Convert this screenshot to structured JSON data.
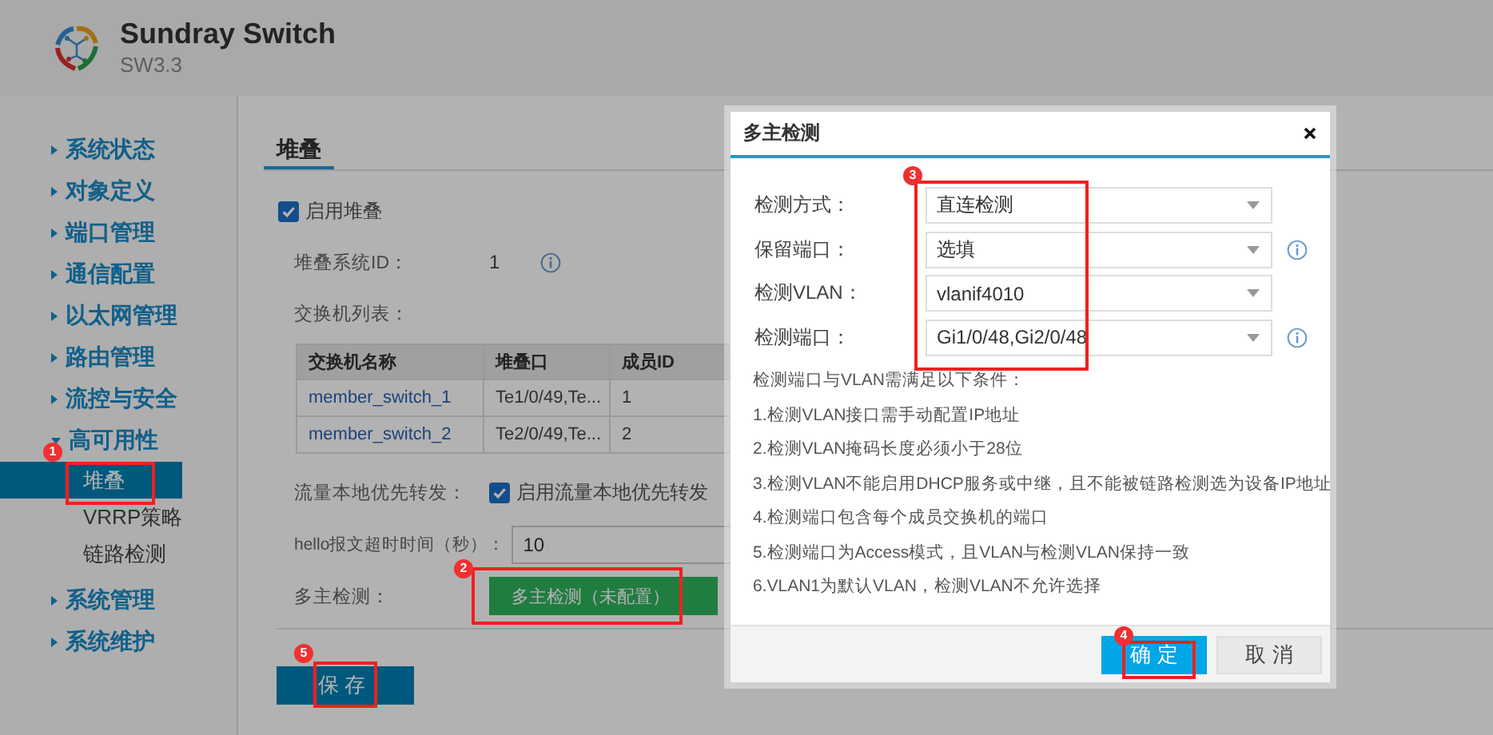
{
  "header": {
    "title": "Sundray Switch",
    "version": "SW3.3"
  },
  "sidebar": {
    "items": [
      {
        "label": "系统状态",
        "expanded": false
      },
      {
        "label": "对象定义",
        "expanded": false
      },
      {
        "label": "端口管理",
        "expanded": false
      },
      {
        "label": "通信配置",
        "expanded": false
      },
      {
        "label": "以太网管理",
        "expanded": false
      },
      {
        "label": "路由管理",
        "expanded": false
      },
      {
        "label": "流控与安全",
        "expanded": false
      },
      {
        "label": "高可用性",
        "expanded": true,
        "children": [
          {
            "label": "堆叠",
            "selected": true,
            "annotation": "1"
          },
          {
            "label": "VRRP策略",
            "selected": false
          },
          {
            "label": "链路检测",
            "selected": false
          }
        ]
      },
      {
        "label": "系统管理",
        "expanded": false
      },
      {
        "label": "系统维护",
        "expanded": false
      }
    ]
  },
  "tabs": [
    {
      "label": "堆叠",
      "selected": true
    }
  ],
  "form": {
    "enable_stack": {
      "label": "启用堆叠",
      "checked": true
    },
    "stack_id": {
      "label": "堆叠系统ID：",
      "value": "1"
    },
    "switch_list": {
      "label": "交换机列表：",
      "columns": [
        "交换机名称",
        "堆叠口",
        "成员ID"
      ],
      "rows": [
        [
          "member_switch_1",
          "Te1/0/49,Te...",
          "1"
        ],
        [
          "member_switch_2",
          "Te2/0/49,Te...",
          "2"
        ]
      ]
    },
    "local_forward": {
      "label": "流量本地优先转发：",
      "option": "启用流量本地优先转发",
      "checked": true
    },
    "hello_timeout": {
      "label": "hello报文超时时间（秒）：",
      "value": "10"
    },
    "multi_detect": {
      "label": "多主检测：",
      "button": "多主检测（未配置）",
      "annotation": "2"
    }
  },
  "save_button": {
    "label": "保 存",
    "annotation": "5"
  },
  "dialog": {
    "title": "多主检测",
    "fields_annotation": "3",
    "fields": [
      {
        "label": "检测方式：",
        "value": "直连检测",
        "info": false
      },
      {
        "label": "保留端口：",
        "value": "选填",
        "info": true
      },
      {
        "label": "检测VLAN：",
        "value": "vlanif4010",
        "info": false
      },
      {
        "label": "检测端口：",
        "value": "Gi1/0/48,Gi2/0/48",
        "info": true
      }
    ],
    "notes": [
      "检测端口与VLAN需满足以下条件：",
      "1.检测VLAN接口需手动配置IP地址",
      "2.检测VLAN掩码长度必须小于28位",
      "3.检测VLAN不能启用DHCP服务或中继，且不能被链路检测选为设备IP地址",
      "4.检测端口包含每个成员交换机的端口",
      "5.检测端口为Access模式，且VLAN与检测VLAN保持一致",
      "6.VLAN1为默认VLAN，检测VLAN不允许选择"
    ],
    "buttons": [
      {
        "label": "确 定",
        "kind": "primary",
        "annotation": "4"
      },
      {
        "label": "取 消",
        "kind": "secondary"
      }
    ]
  }
}
